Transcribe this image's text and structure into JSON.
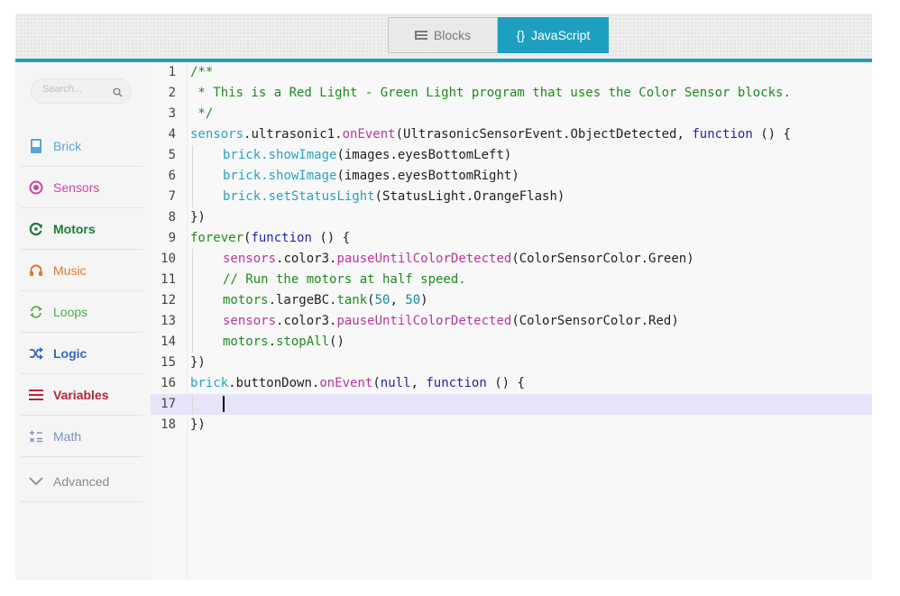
{
  "topbar": {
    "blocks_label": "Blocks",
    "javascript_label": "JavaScript",
    "javascript_icon_text": "{}",
    "active_view": "javascript",
    "accent_color": "#1f9fbf"
  },
  "sidebar": {
    "search": {
      "placeholder": "Search...",
      "value": ""
    },
    "categories": [
      {
        "label": "Brick",
        "color": "#5aa6d8",
        "icon": "brick-icon"
      },
      {
        "label": "Sensors",
        "color": "#c9489d",
        "icon": "sensors-icon"
      },
      {
        "label": "Motors",
        "color": "#1e7a3a",
        "icon": "motors-icon"
      },
      {
        "label": "Music",
        "color": "#e4762c",
        "icon": "music-icon"
      },
      {
        "label": "Loops",
        "color": "#4fae4f",
        "icon": "loops-icon"
      },
      {
        "label": "Logic",
        "color": "#2f6bb8",
        "icon": "logic-icon"
      },
      {
        "label": "Variables",
        "color": "#b3263a",
        "icon": "variables-icon"
      },
      {
        "label": "Math",
        "color": "#7c8fc2",
        "icon": "math-icon"
      },
      {
        "label": "Advanced",
        "color": "#8a8a8a",
        "icon": "chevron-down-icon"
      }
    ]
  },
  "editor": {
    "line_numbers": [
      "1",
      "2",
      "3",
      "4",
      "5",
      "6",
      "7",
      "8",
      "9",
      "10",
      "11",
      "12",
      "13",
      "14",
      "15",
      "16",
      "17",
      "18"
    ],
    "current_line": 17,
    "code": {
      "l1": "/**",
      "l2": " * This is a Red Light - Green Light program that uses the Color Sensor blocks.",
      "l3": " */",
      "l4": {
        "a": "sensors",
        "b": ".ultrasonic1.",
        "c": "onEvent",
        "d": "(UltrasonicSensorEvent.ObjectDetected, ",
        "e": "function",
        "f": " () {"
      },
      "l5": {
        "a": "brick",
        "b": ".",
        "c": "showImage",
        "d": "(images.eyesBottomLeft)"
      },
      "l6": {
        "a": "brick",
        "b": ".",
        "c": "showImage",
        "d": "(images.eyesBottomRight)"
      },
      "l7": {
        "a": "brick",
        "b": ".",
        "c": "setStatusLight",
        "d": "(StatusLight.OrangeFlash)"
      },
      "l8": "})",
      "l9": {
        "a": "forever",
        "b": "(",
        "c": "function",
        "d": " () {"
      },
      "l10": {
        "a": "sensors",
        "b": ".color3.",
        "c": "pauseUntilColorDetected",
        "d": "(ColorSensorColor.Green)"
      },
      "l11": "// Run the motors at half speed.",
      "l12": {
        "a": "motors",
        "b": ".largeBC.",
        "c": "tank",
        "d": "(",
        "e": "50",
        "f": ", ",
        "g": "50",
        "h": ")"
      },
      "l13": {
        "a": "sensors",
        "b": ".color3.",
        "c": "pauseUntilColorDetected",
        "d": "(ColorSensorColor.Red)"
      },
      "l14": {
        "a": "motors",
        "b": ".",
        "c": "stopAll",
        "d": "()"
      },
      "l15": "})",
      "l16": {
        "a": "brick",
        "b": ".buttonDown.",
        "c": "onEvent",
        "d": "(",
        "e": "null",
        "f": ", ",
        "g": "function",
        "h": " () {"
      },
      "l17": "",
      "l18": "})"
    }
  }
}
